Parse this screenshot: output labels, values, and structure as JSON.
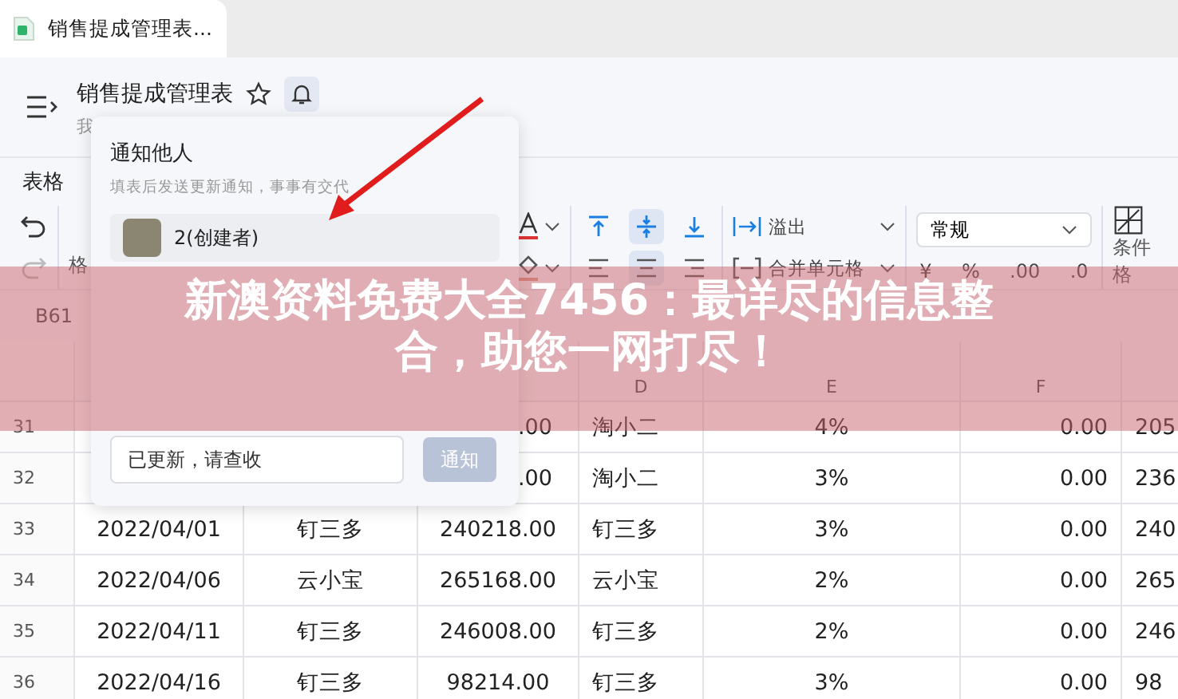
{
  "tab": {
    "title": "销售提成管理表..."
  },
  "header": {
    "title": "销售提成管理表",
    "subtitle": "我",
    "bell_selected": true
  },
  "menu": {
    "items": [
      "表格"
    ]
  },
  "toolbar": {
    "left_label": "格",
    "vertical_align": [
      {
        "kind": "top",
        "selected": false
      },
      {
        "kind": "middle",
        "selected": true
      },
      {
        "kind": "bottom",
        "selected": false
      }
    ],
    "horizontal_align": [
      {
        "kind": "left",
        "selected": false
      },
      {
        "kind": "center",
        "selected": true
      },
      {
        "kind": "right",
        "selected": false
      }
    ],
    "overflow": "溢出",
    "merge": "合并单元格",
    "format": "常规",
    "number_buttons": [
      "¥",
      "%",
      ".00",
      ".0"
    ],
    "conditional": "条件格"
  },
  "sheet": {
    "name_box": "B61",
    "columns": [
      {},
      {},
      {},
      {
        "header": "D"
      },
      {
        "header": "E"
      },
      {
        "header": "F"
      },
      {}
    ],
    "rows": [
      {
        "number": "31",
        "cells": [
          "",
          "",
          ".00",
          "淘小二",
          "4%",
          "0.00",
          "205"
        ]
      },
      {
        "number": "32",
        "cells": [
          "",
          "",
          ".00",
          "淘小二",
          "3%",
          "0.00",
          "236"
        ]
      },
      {
        "number": "33",
        "cells": [
          "2022/04/01",
          "钉三多",
          "240218.00",
          "钉三多",
          "3%",
          "0.00",
          "240"
        ]
      },
      {
        "number": "34",
        "cells": [
          "2022/04/06",
          "云小宝",
          "265168.00",
          "云小宝",
          "2%",
          "0.00",
          "265"
        ]
      },
      {
        "number": "35",
        "cells": [
          "2022/04/11",
          "钉三多",
          "246008.00",
          "钉三多",
          "2%",
          "0.00",
          "246"
        ]
      },
      {
        "number": "36",
        "cells": [
          "2022/04/16",
          "钉三多",
          "98214.00",
          "钉三多",
          "3%",
          "0.00",
          "98"
        ]
      }
    ]
  },
  "popup": {
    "title": "通知他人",
    "hint": "填表后发送更新通知，事事有交代",
    "user": "2(创建者)",
    "message": "已更新，请查收",
    "button": "通知",
    "button_disabled": true
  },
  "banner": {
    "lines": [
      "新澳资料免费大全7456：最详尽的信息整",
      "合，助您一网打尽！"
    ]
  }
}
